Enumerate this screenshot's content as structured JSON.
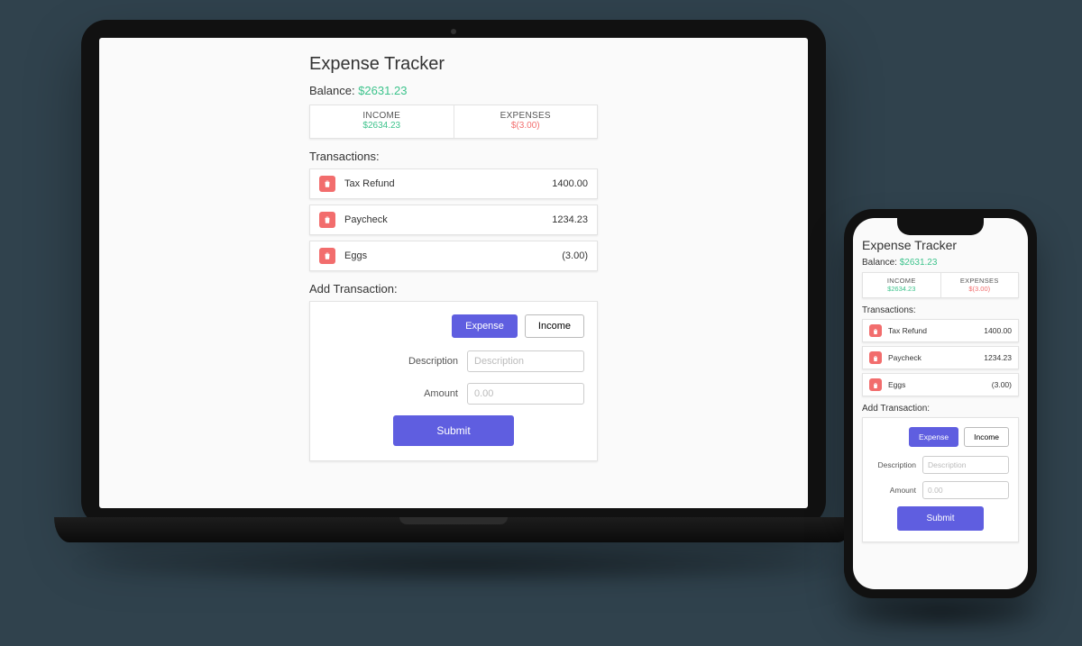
{
  "app": {
    "title": "Expense Tracker",
    "balance_label": "Balance: ",
    "balance_value": "$2631.23",
    "summary": {
      "income_label": "INCOME",
      "income_value": "$2634.23",
      "expenses_label": "EXPENSES",
      "expenses_value": "$(3.00)"
    },
    "transactions_heading": "Transactions:",
    "transactions": [
      {
        "description": "Tax Refund",
        "amount": "1400.00"
      },
      {
        "description": "Paycheck",
        "amount": "1234.23"
      },
      {
        "description": "Eggs",
        "amount": "(3.00)"
      }
    ],
    "add_heading": "Add Transaction:",
    "toggle": {
      "expense": "Expense",
      "income": "Income",
      "active": "expense"
    },
    "form": {
      "description_label": "Description",
      "description_placeholder": "Description",
      "amount_label": "Amount",
      "amount_placeholder": "0.00",
      "submit": "Submit"
    }
  }
}
